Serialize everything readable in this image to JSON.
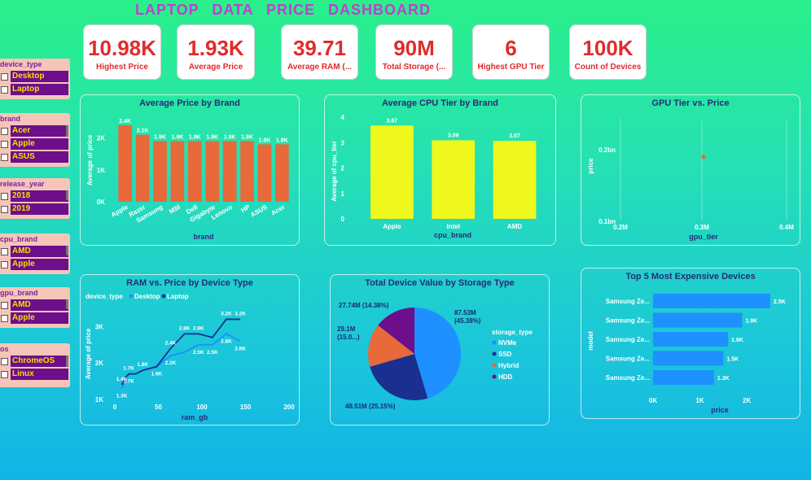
{
  "title": "LAPTOP   DATA   PRICE   DASHBOARD",
  "kpis": [
    {
      "value": "10.98K",
      "label": "Highest Price"
    },
    {
      "value": "1.93K",
      "label": "Average Price"
    },
    {
      "value": "39.71",
      "label": "Average RAM (..."
    },
    {
      "value": "90M",
      "label": "Total Storage (..."
    },
    {
      "value": "6",
      "label": "Highest GPU Tier"
    },
    {
      "value": "100K",
      "label": "Count of Devices"
    }
  ],
  "slicers": [
    {
      "header": "device_type",
      "items": [
        "Desktop",
        "Laptop"
      ]
    },
    {
      "header": "brand",
      "items": [
        "Acer",
        "Apple",
        "ASUS"
      ]
    },
    {
      "header": "release_year",
      "items": [
        "2018",
        "2019"
      ]
    },
    {
      "header": "cpu_brand",
      "items": [
        "AMD",
        "Apple"
      ]
    },
    {
      "header": "gpu_brand",
      "items": [
        "AMD",
        "Apple"
      ]
    },
    {
      "header": "os",
      "items": [
        "ChromeOS",
        "Linux"
      ]
    }
  ],
  "colors": {
    "orange": "#e8693a",
    "yellow": "#eef81c",
    "blue": "#1e90ff",
    "navy": "#1a2f8f",
    "purple": "#6d0e8a",
    "red": "#e02b2b"
  },
  "chart_data": [
    {
      "id": "avg-price-brand",
      "type": "bar",
      "title": "Average Price by Brand",
      "xlabel": "brand",
      "ylabel": "Average of price",
      "categories": [
        "Apple",
        "Razer",
        "Samsung",
        "MSI",
        "Dell",
        "Gigabyte",
        "Lenovo",
        "HP",
        "ASUS",
        "Acer"
      ],
      "values": [
        2400,
        2100,
        1900,
        1900,
        1900,
        1900,
        1900,
        1900,
        1800,
        1800
      ],
      "labels": [
        "2.4K",
        "2.1K",
        "1.9K",
        "1.9K",
        "1.9K",
        "1.9K",
        "1.9K",
        "1.9K",
        "1.8K",
        "1.8K"
      ],
      "yticks": [
        "0K",
        "1K",
        "2K"
      ],
      "ylim": [
        0,
        2600
      ]
    },
    {
      "id": "avg-cpu-brand",
      "type": "bar",
      "title": "Average CPU Tier by Brand",
      "xlabel": "cpu_brand",
      "ylabel": "Average of cpu_tier",
      "categories": [
        "Apple",
        "Intel",
        "AMD"
      ],
      "values": [
        3.67,
        3.09,
        3.07
      ],
      "labels": [
        "3.67",
        "3.09",
        "3.07"
      ],
      "yticks": [
        "0",
        "1",
        "2",
        "3",
        "4"
      ],
      "ylim": [
        0,
        4
      ]
    },
    {
      "id": "gpu-price",
      "type": "scatter",
      "title": "GPU Tier vs. Price",
      "xlabel": "gpu_tier",
      "ylabel": "price",
      "xticks": [
        "0.2M",
        "0.3M",
        "0.4M"
      ],
      "yticks": [
        "0.1bn",
        "0.2bn"
      ],
      "points": [
        {
          "x": 0.3,
          "y": 0.19
        }
      ]
    },
    {
      "id": "ram-price",
      "type": "line",
      "title": "RAM vs. Price by Device Type",
      "xlabel": "ram_gb",
      "ylabel": "Average of price",
      "legend_title": "device_type",
      "xticks": [
        "0",
        "50",
        "100",
        "150",
        "200"
      ],
      "yticks": [
        "1K",
        "2K",
        "3K"
      ],
      "xlim": [
        0,
        200
      ],
      "ylim": [
        1000,
        3500
      ],
      "series": [
        {
          "name": "Desktop",
          "x": [
            8,
            12,
            16,
            24,
            32,
            48,
            64,
            80,
            96,
            112,
            128,
            144
          ],
          "y": [
            1300,
            1500,
            1700,
            1700,
            1800,
            1900,
            2200,
            2300,
            2500,
            2500,
            2800,
            2600
          ],
          "labels": [
            "1.3K",
            "",
            "1.7K",
            "",
            "",
            "1.9K",
            "2.2K",
            "",
            "2.5K",
            "2.5K",
            "2.8K",
            "2.6K"
          ]
        },
        {
          "name": "Laptop",
          "x": [
            8,
            12,
            16,
            24,
            32,
            48,
            64,
            80,
            96,
            112,
            128,
            144
          ],
          "y": [
            1400,
            1600,
            1700,
            1700,
            1800,
            1900,
            2400,
            2800,
            2800,
            2700,
            3200,
            3200
          ],
          "labels": [
            "1.4K",
            "",
            "1.7K",
            "",
            "1.8K",
            "",
            "2.4K",
            "2.8K",
            "2.8K",
            "",
            "3.2K",
            "3.2K"
          ]
        }
      ]
    },
    {
      "id": "storage-value",
      "type": "pie",
      "title": "Total Device Value by Storage Type",
      "legend_title": "storage_type",
      "slices": [
        {
          "name": "NVMe",
          "value": 87.53,
          "label": "87.53M (45.38%)"
        },
        {
          "name": "SSD",
          "value": 48.51,
          "label": "48.51M (25.15%)"
        },
        {
          "name": "Hybrid",
          "value": 29.1,
          "label": "29.1M (15.0...)"
        },
        {
          "name": "HDD",
          "value": 27.74,
          "label": "27.74M (14.38%)"
        }
      ]
    },
    {
      "id": "top5-devices",
      "type": "bar",
      "orientation": "horizontal",
      "title": "Top 5 Most Expensive Devices",
      "xlabel": "price",
      "ylabel": "model",
      "categories": [
        "Samsung Ze...",
        "Samsung Ze...",
        "Samsung Ze...",
        "Samsung Ze...",
        "Samsung Ze..."
      ],
      "values": [
        2.5,
        1.9,
        1.6,
        1.5,
        1.3
      ],
      "labels": [
        "2.5K",
        "1.9K",
        "1.6K",
        "1.5K",
        "1.3K"
      ],
      "xticks": [
        "0K",
        "1K",
        "2K"
      ],
      "xlim": [
        0,
        2.5
      ]
    }
  ]
}
